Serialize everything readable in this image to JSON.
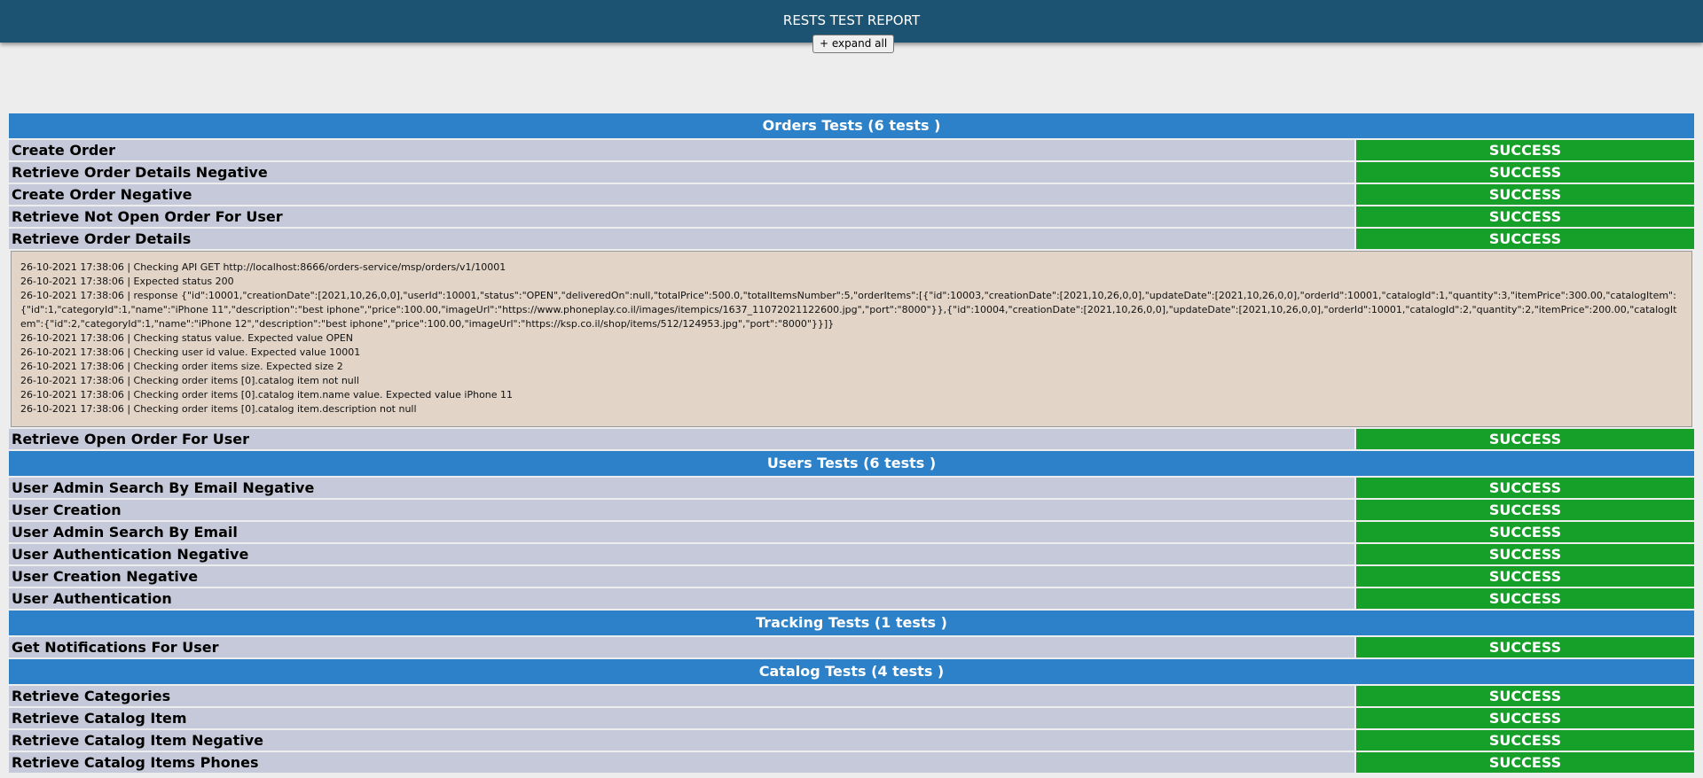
{
  "header": {
    "title": "RESTS TEST REPORT"
  },
  "toolbar": {
    "expand_label": "+ expand all"
  },
  "colors": {
    "header": "#1c5272",
    "suite": "#2d81c8",
    "success": "#16a02a",
    "test_row": "#c6c9d9",
    "log": "#e2d5c8"
  },
  "orders": {
    "title": "Orders Tests (6 tests )",
    "tests": [
      {
        "name": "Create Order",
        "status": "SUCCESS"
      },
      {
        "name": "Retrieve Order Details Negative",
        "status": "SUCCESS"
      },
      {
        "name": "Create Order Negative",
        "status": "SUCCESS"
      },
      {
        "name": "Retrieve Not Open Order For User",
        "status": "SUCCESS"
      },
      {
        "name": "Retrieve Order Details",
        "status": "SUCCESS"
      },
      {
        "name": "Retrieve Open Order For User",
        "status": "SUCCESS"
      }
    ],
    "log": [
      "26-10-2021 17:38:06 | Checking API GET http://localhost:8666/orders-service/msp/orders/v1/10001",
      "26-10-2021 17:38:06 | Expected status 200",
      "26-10-2021 17:38:06 | response {\"id\":10001,\"creationDate\":[2021,10,26,0,0],\"userId\":10001,\"status\":\"OPEN\",\"deliveredOn\":null,\"totalPrice\":500.0,\"totalItemsNumber\":5,\"orderItems\":[{\"id\":10003,\"creationDate\":[2021,10,26,0,0],\"updateDate\":[2021,10,26,0,0],\"orderId\":10001,\"catalogId\":1,\"quantity\":3,\"itemPrice\":300.00,\"catalogItem\":{\"id\":1,\"categoryId\":1,\"name\":\"iPhone 11\",\"description\":\"best iphone\",\"price\":100.00,\"imageUrl\":\"https://www.phoneplay.co.il/images/itempics/1637_11072021122600.jpg\",\"port\":\"8000\"}},{\"id\":10004,\"creationDate\":[2021,10,26,0,0],\"updateDate\":[2021,10,26,0,0],\"orderId\":10001,\"catalogId\":2,\"quantity\":2,\"itemPrice\":200.00,\"catalogItem\":{\"id\":2,\"categoryId\":1,\"name\":\"iPhone 12\",\"description\":\"best iphone\",\"price\":100.00,\"imageUrl\":\"https://ksp.co.il/shop/items/512/124953.jpg\",\"port\":\"8000\"}}]}",
      "26-10-2021 17:38:06 | Checking status value. Expected value OPEN",
      "26-10-2021 17:38:06 | Checking user id value. Expected value 10001",
      "26-10-2021 17:38:06 | Checking order items size. Expected size 2",
      "26-10-2021 17:38:06 | Checking order items [0].catalog item not null",
      "26-10-2021 17:38:06 | Checking order items [0].catalog item.name value. Expected value iPhone 11",
      "26-10-2021 17:38:06 | Checking order items [0].catalog item.description not null"
    ]
  },
  "users": {
    "title": "Users Tests (6 tests )",
    "tests": [
      {
        "name": "User Admin Search By Email Negative",
        "status": "SUCCESS"
      },
      {
        "name": "User Creation",
        "status": "SUCCESS"
      },
      {
        "name": "User Admin Search By Email",
        "status": "SUCCESS"
      },
      {
        "name": "User Authentication Negative",
        "status": "SUCCESS"
      },
      {
        "name": "User Creation Negative",
        "status": "SUCCESS"
      },
      {
        "name": "User Authentication",
        "status": "SUCCESS"
      }
    ]
  },
  "tracking": {
    "title": "Tracking Tests (1 tests )",
    "tests": [
      {
        "name": "Get Notifications For User",
        "status": "SUCCESS"
      }
    ]
  },
  "catalog": {
    "title": "Catalog Tests (4 tests )",
    "tests": [
      {
        "name": "Retrieve Categories",
        "status": "SUCCESS"
      },
      {
        "name": "Retrieve Catalog Item",
        "status": "SUCCESS"
      },
      {
        "name": "Retrieve Catalog Item Negative",
        "status": "SUCCESS"
      },
      {
        "name": "Retrieve Catalog Items Phones",
        "status": "SUCCESS"
      }
    ]
  }
}
